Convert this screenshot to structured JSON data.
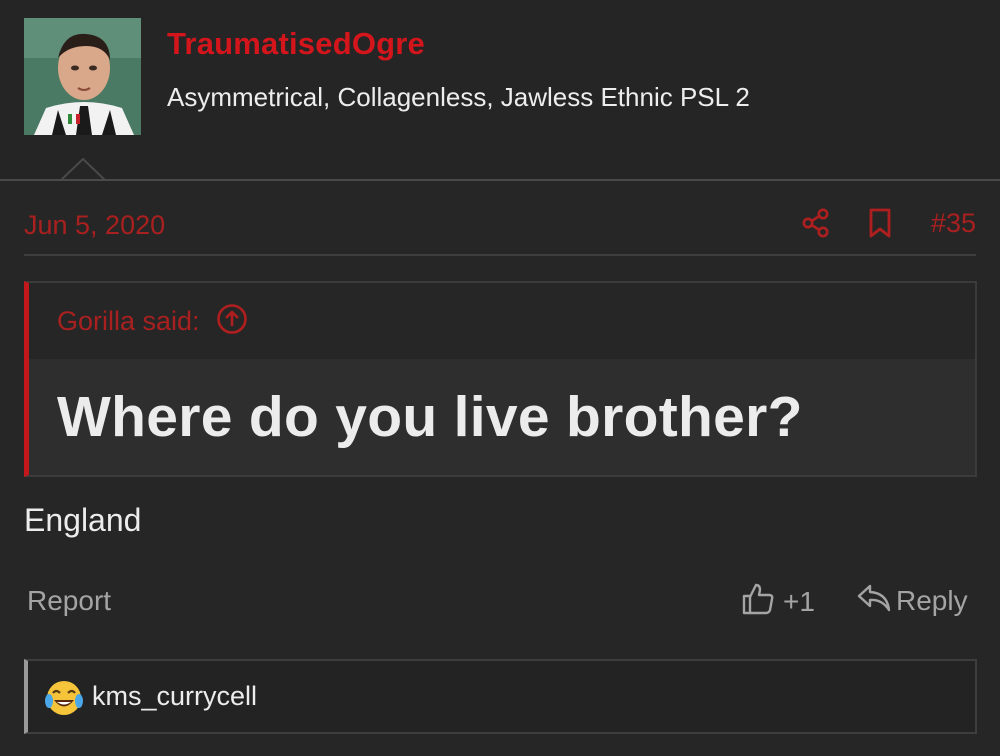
{
  "user": {
    "username": "TraumatisedOgre",
    "title": "Asymmetrical, Collagenless, Jawless Ethnic PSL 2",
    "avatar_icon": "user-avatar-photo"
  },
  "meta": {
    "date": "Jun 5, 2020",
    "share_icon": "share-icon",
    "bookmark_icon": "bookmark-icon",
    "post_number": "#35"
  },
  "quote": {
    "author": "Gorilla said:",
    "expand_icon": "arrow-up-circle-icon",
    "text": "Where do you live brother?"
  },
  "message": "England",
  "actions": {
    "report": "Report",
    "like_count": "+1",
    "reply": "Reply"
  },
  "reactions": {
    "emoji": "crying-laughing-emoji",
    "user": "kms_currycell"
  },
  "colors": {
    "accent_red": "#d4161c",
    "muted_red": "#a8201f",
    "background": "#262626",
    "muted_text": "#a4a4a4"
  }
}
